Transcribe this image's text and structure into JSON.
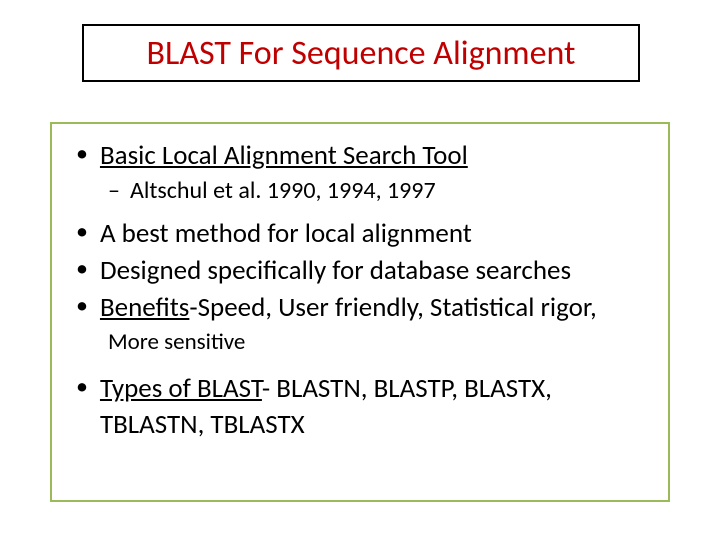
{
  "title": "BLAST For Sequence Alignment",
  "bullets": {
    "b1": "Basic Local Alignment Search Tool",
    "b1_sub": "Altschul et al. 1990, 1994, 1997",
    "b2": "A best method for local alignment",
    "b3": "Designed specifically for database searches",
    "b4_prefix": "Benefits",
    "b4_rest": "-Speed, User friendly, Statistical rigor,",
    "b4_more": "More sensitive",
    "b5_prefix": " Types of BLAST",
    "b5_rest": "- BLASTN, BLASTP, BLASTX, TBLASTN, TBLASTX"
  },
  "glyphs": {
    "bullet": "•",
    "dash": "–"
  }
}
